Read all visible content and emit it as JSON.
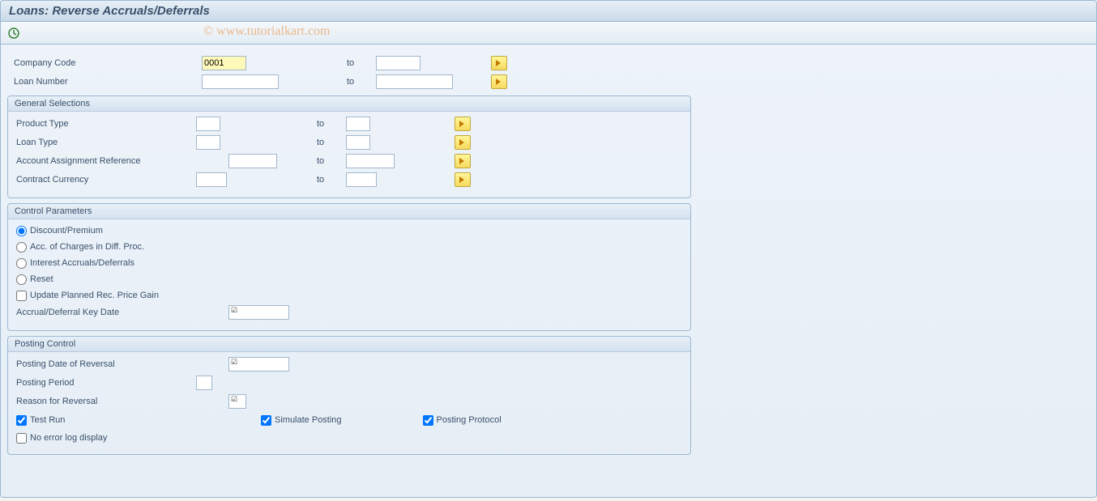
{
  "title": "Loans: Reverse Accruals/Deferrals",
  "watermark": "© www.tutorialkart.com",
  "header": {
    "company_code_label": "Company Code",
    "company_code_from": "0001",
    "company_code_to": "",
    "loan_number_label": "Loan Number",
    "loan_number_from": "",
    "loan_number_to": "",
    "to_label": "to"
  },
  "general": {
    "title": "General Selections",
    "product_type_label": "Product Type",
    "product_type_from": "",
    "product_type_to": "",
    "loan_type_label": "Loan Type",
    "loan_type_from": "",
    "loan_type_to": "",
    "aar_label": "Account Assignment Reference",
    "aar_from": "",
    "aar_to": "",
    "currency_label": "Contract Currency",
    "currency_from": "",
    "currency_to": ""
  },
  "control": {
    "title": "Control Parameters",
    "r_discount": "Discount/Premium",
    "r_acc": "Acc. of Charges in Diff. Proc.",
    "r_interest": "Interest Accruals/Deferrals",
    "r_reset": "Reset",
    "c_update": "Update Planned Rec. Price Gain",
    "keydate_label": "Accrual/Deferral Key Date",
    "keydate_value": ""
  },
  "posting": {
    "title": "Posting Control",
    "posting_date_label": "Posting Date of Reversal",
    "posting_date_value": "",
    "posting_period_label": "Posting Period",
    "posting_period_value": "",
    "reason_label": "Reason for Reversal",
    "reason_value": "",
    "test_run": "Test Run",
    "simulate": "Simulate Posting",
    "protocol": "Posting Protocol",
    "no_error": "No error log display"
  }
}
